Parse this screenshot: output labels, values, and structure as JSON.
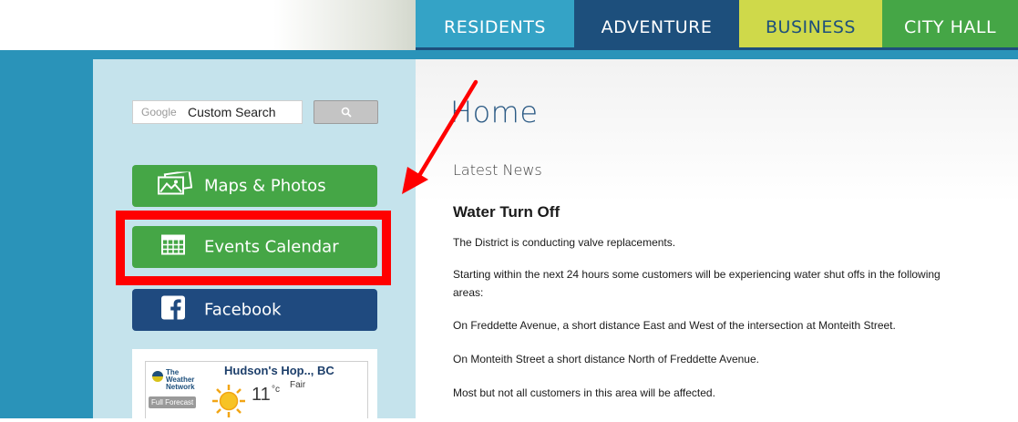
{
  "nav": {
    "tabs": [
      "Residents",
      "Adventure",
      "Business",
      "City Hall"
    ]
  },
  "search": {
    "brand": "Google",
    "placeholder": "Custom Search"
  },
  "sidebar": {
    "buttons": [
      {
        "label": "Maps & Photos",
        "icon": "photos-icon"
      },
      {
        "label": "Events Calendar",
        "icon": "calendar-icon"
      },
      {
        "label": "Facebook",
        "icon": "facebook-icon"
      }
    ]
  },
  "weather": {
    "provider": "The Weather Network",
    "location": "Hudson's Hop.., BC",
    "forecast_label": "Full Forecast",
    "temperature": "11",
    "unit": "°c",
    "condition": "Fair"
  },
  "main": {
    "title": "Home",
    "section": "Latest News",
    "article": {
      "title": "Water Turn Off",
      "paragraphs": [
        "The District is conducting valve replacements.",
        "Starting within the next 24 hours some customers will be experiencing water shut offs in the following areas:",
        "On Freddette Avenue, a short distance East and West of the intersection at Monteith Street.",
        "On Monteith Street a short distance North of Freddette Avenue.",
        "Most but not all customers in this area will be affected."
      ]
    }
  },
  "colors": {
    "frame": "#2a93b9",
    "sidebar": "#c5e3ec",
    "green": "#45a646",
    "navy": "#1f4a7f",
    "highlight": "#ff0000"
  }
}
